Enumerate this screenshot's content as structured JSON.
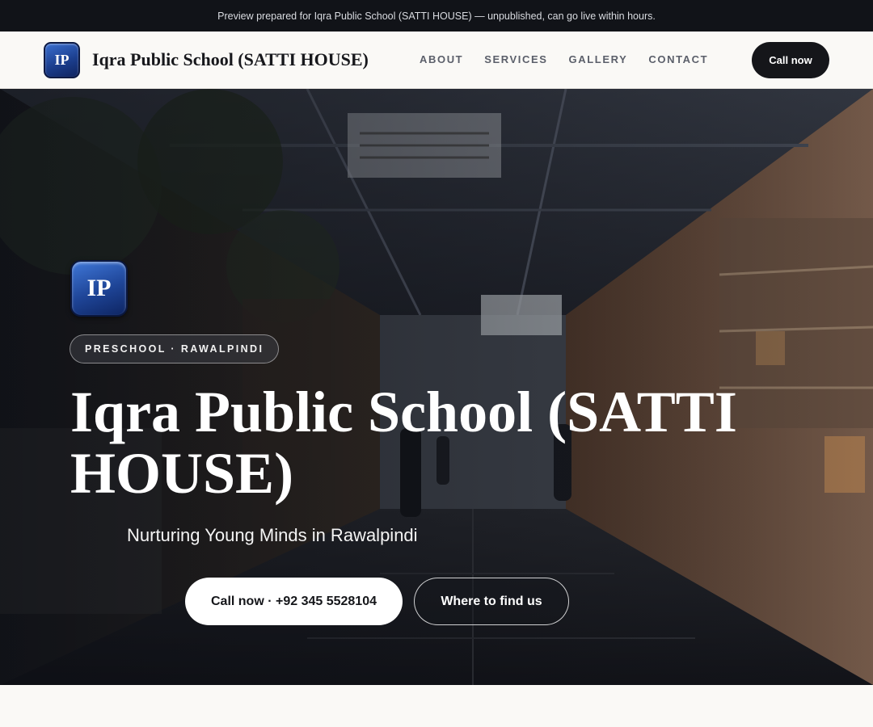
{
  "banner": {
    "text": "Preview prepared for Iqra Public School (SATTI HOUSE) — unpublished, can go live within hours."
  },
  "header": {
    "logo_initials": "IP",
    "site_name": "Iqra Public School (SATTI HOUSE)",
    "nav": [
      {
        "label": "ABOUT"
      },
      {
        "label": "SERVICES"
      },
      {
        "label": "GALLERY"
      },
      {
        "label": "CONTACT"
      }
    ],
    "cta_label": "Call now"
  },
  "hero": {
    "logo_initials": "IP",
    "tag": "PRESCHOOL · RAWALPINDI",
    "title": "Iqra Public School (SATTI HOUSE)",
    "subtitle": "Nurturing Young Minds in Rawalpindi",
    "primary_button": "Call now · +92 345 5528104",
    "secondary_button": "Where to find us"
  },
  "colors": {
    "banner_bg": "#111318",
    "accent_dark": "#15161a",
    "logo_blue": "#1e4496"
  }
}
